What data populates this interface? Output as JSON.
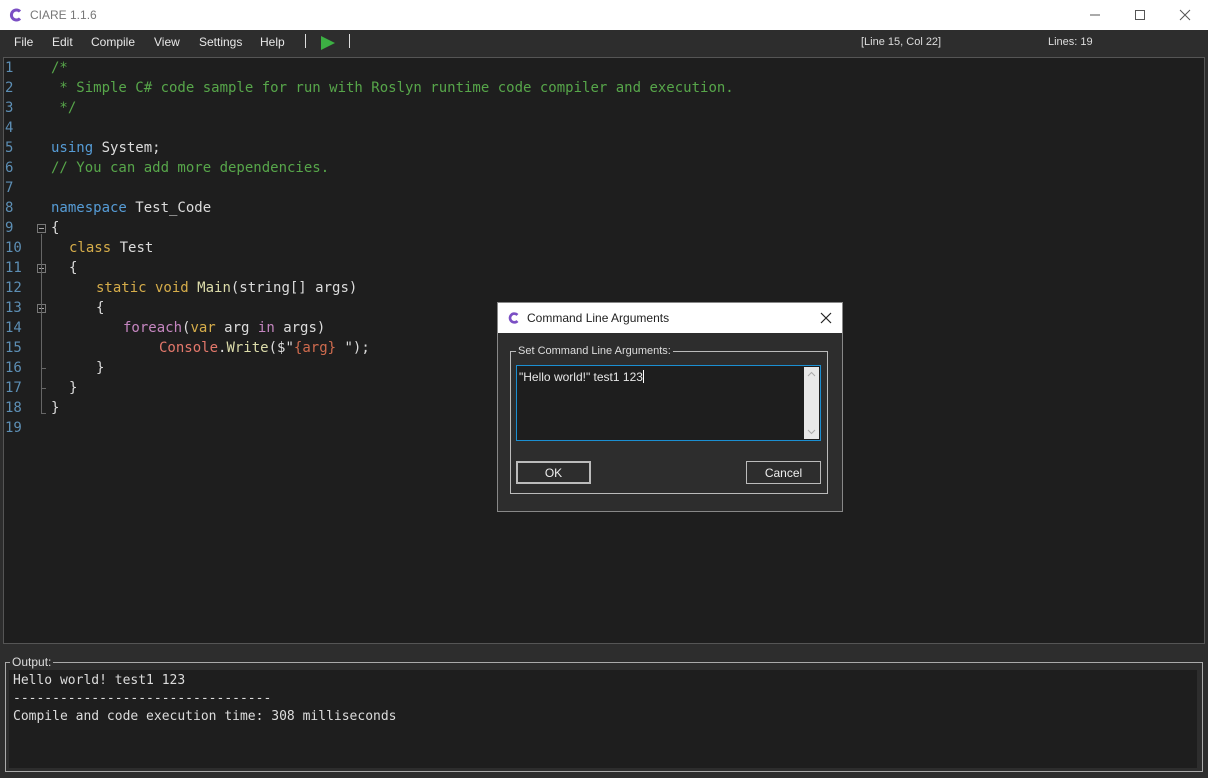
{
  "window": {
    "title": "CIARE 1.1.6"
  },
  "menu": {
    "items": [
      "File",
      "Edit",
      "Compile",
      "View",
      "Settings",
      "Help"
    ],
    "cursor_position": "[Line 15, Col 22]",
    "line_count": "Lines: 19"
  },
  "editor": {
    "line_numbers": [
      "1",
      "2",
      "3",
      "4",
      "5",
      "6",
      "7",
      "8",
      "9",
      "10",
      "11",
      "12",
      "13",
      "14",
      "15",
      "16",
      "17",
      "18",
      "19"
    ],
    "code": {
      "l1": "/*",
      "l2": " * Simple C# code sample for run with Roslyn runtime code compiler and execution.",
      "l3": " */",
      "l5_kw": "using",
      "l5_rest": " System;",
      "l6": "// You can add more dependencies.",
      "l8_kw": "namespace",
      "l8_rest": " Test_Code",
      "l9": "{",
      "l10_kw": "class",
      "l10_rest": " Test",
      "l11": "{",
      "l12_kw": "static void",
      "l12_method": "Main",
      "l12_rest": "(string[] args)",
      "l13": "{",
      "l14_kw": "foreach",
      "l14_p1": "(",
      "l14_var": "var",
      "l14_p2": " arg ",
      "l14_in": "in",
      "l14_p3": " args)",
      "l15_class": "Console",
      "l15_dot": ".",
      "l15_method": "Write",
      "l15_p1": "($\"",
      "l15_interp": "{arg}",
      "l15_p2": " \");",
      "l16": "}",
      "l17": "}",
      "l18": "}"
    }
  },
  "output": {
    "label": "Output:",
    "lines": [
      "Hello world! test1 123",
      "---------------------------------",
      "Compile and code execution time: 308 milliseconds"
    ]
  },
  "dialog": {
    "title": "Command Line Arguments",
    "group_label": "Set Command Line Arguments:",
    "args_value": "\"Hello world!\" test1 123",
    "ok_label": "OK",
    "cancel_label": "Cancel"
  },
  "colors": {
    "background": "#2d2d2d",
    "editor_bg": "#1e1e1e",
    "line_number": "#5d8fb5",
    "comment": "#57a64a",
    "keyword": "#569cd6",
    "run_green": "#3cb043",
    "logo_purple": "#7b4fc4"
  },
  "icons": {
    "app_logo": "ciare-logo-icon",
    "run": "play-icon",
    "minimize": "minimize-icon",
    "maximize": "maximize-icon",
    "close": "close-icon"
  }
}
